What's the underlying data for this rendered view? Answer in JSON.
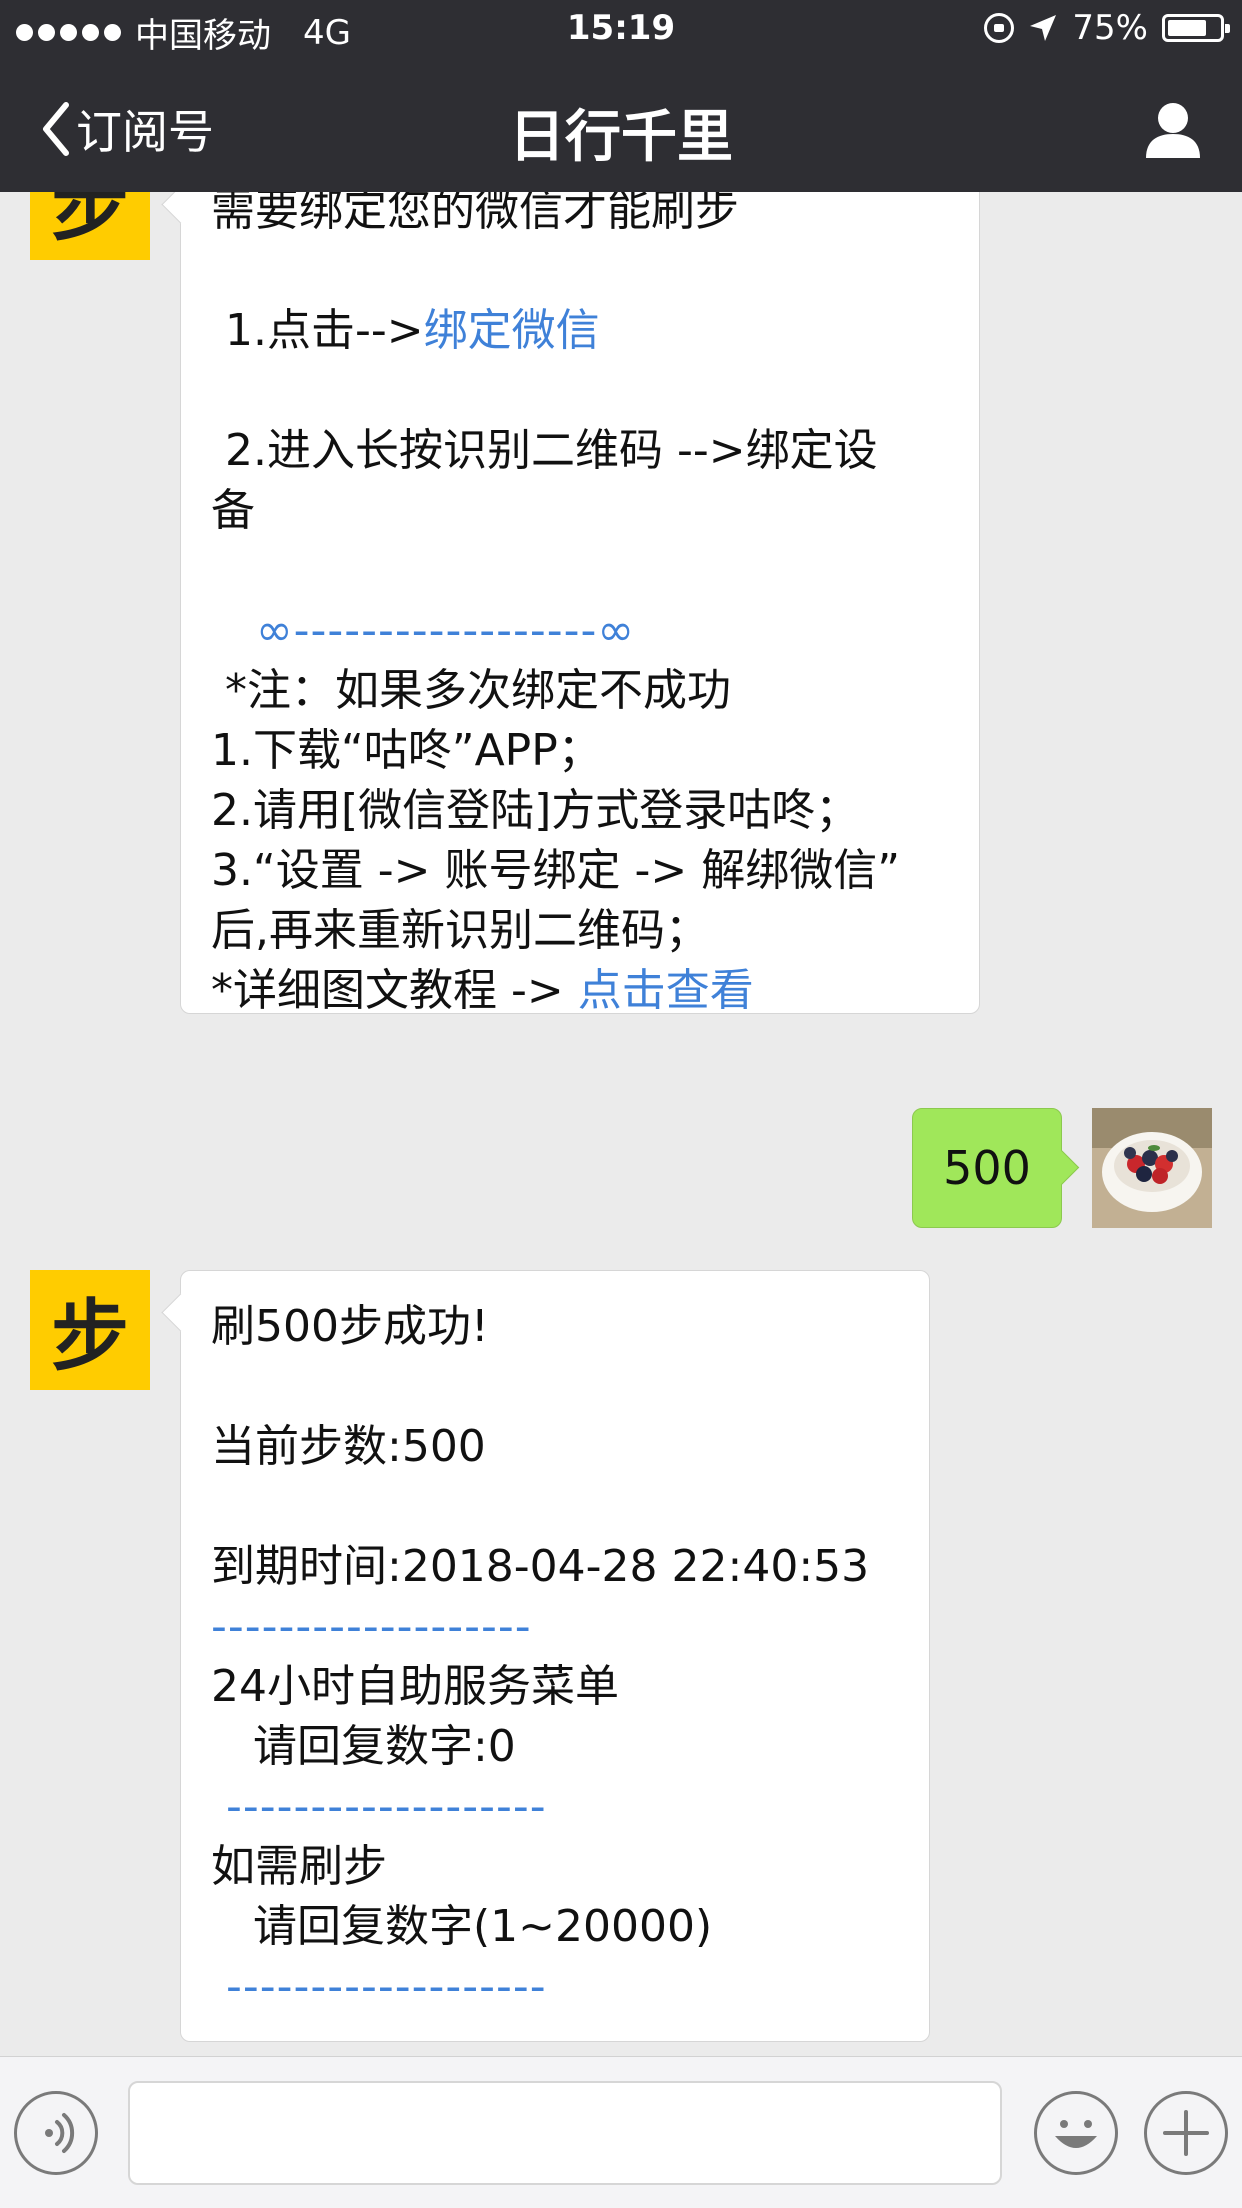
{
  "status_bar": {
    "carrier": "中国移动",
    "network": "4G",
    "time": "15:19",
    "battery": "75%",
    "battery_level": 0.75,
    "signal_dots": 5,
    "icons": [
      "rotation-lock-icon",
      "location-arrow-icon",
      "battery-icon"
    ]
  },
  "nav": {
    "back_label": "订阅号",
    "title": "日行千里",
    "right_icon": "person-icon"
  },
  "messages": {
    "bot_avatar_char": "步",
    "msg1": {
      "line1": "需要绑定您的微信才能刷步",
      "step1_prefix": " 1.点击-->",
      "step1_link": "绑定微信",
      "step2_line1": " 2.进入长按识别二维码 -->绑定设",
      "step2_line2": "备",
      "divider": "   ∞------------------∞",
      "note_title": " *注：如果多次绑定不成功",
      "note1": "1.下载“咕咚”APP；",
      "note2": "2.请用[微信登陆]方式登录咕咚；",
      "note3_line1": "3.“设置 -> 账号绑定 -> 解绑微信”",
      "note3_line2": "后,再来重新识别二维码；",
      "detail_prefix": "*详细图文教程 -> ",
      "detail_link": "点击查看"
    },
    "user_msg": "500",
    "msg2": {
      "line1": "刷500步成功!",
      "current_steps": "当前步数:500",
      "expiry": "到期时间:2018-04-28 22:40:53",
      "divider1": "-------------------",
      "menu_title": "24小时自助服务菜单",
      "menu_reply": "   请回复数字:0",
      "divider2": " -------------------",
      "steps_title": "如需刷步",
      "steps_reply": "   请回复数字(1~20000)",
      "divider3": " -------------------"
    }
  },
  "colors": {
    "bar_bg": "#2e2e33",
    "chat_bg": "#ebebeb",
    "link": "#3f81d8",
    "user_bubble": "#a0e75a",
    "bot_avatar": "#ffcc00"
  },
  "input_bar": {
    "voice_icon": "voice-icon",
    "emoji_icon": "emoji-icon",
    "plus_icon": "plus-icon",
    "text_value": ""
  }
}
